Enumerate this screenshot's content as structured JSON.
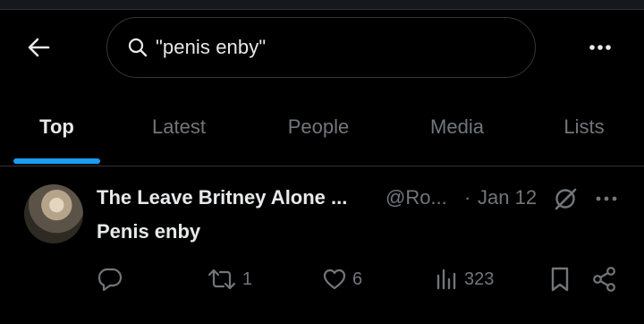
{
  "header": {
    "search_value": "\"penis enby\""
  },
  "tabs": [
    {
      "label": "Top",
      "active": true
    },
    {
      "label": "Latest",
      "active": false
    },
    {
      "label": "People",
      "active": false
    },
    {
      "label": "Media",
      "active": false
    },
    {
      "label": "Lists",
      "active": false
    }
  ],
  "tweet": {
    "display_name": "The Leave Britney Alone ...",
    "handle": "@Ro...",
    "separator": "·",
    "date": "Jan 12",
    "text": "Penis enby",
    "replies": "",
    "retweets": "1",
    "likes": "6",
    "views": "323"
  },
  "colors": {
    "accent": "#1d9bf0",
    "background": "#000000",
    "muted": "#71767b",
    "text": "#e7e9ea"
  },
  "icons": [
    "back-arrow-icon",
    "search-icon",
    "more-icon",
    "grok-icon",
    "reply-icon",
    "retweet-icon",
    "like-icon",
    "views-icon",
    "bookmark-icon",
    "share-icon"
  ]
}
